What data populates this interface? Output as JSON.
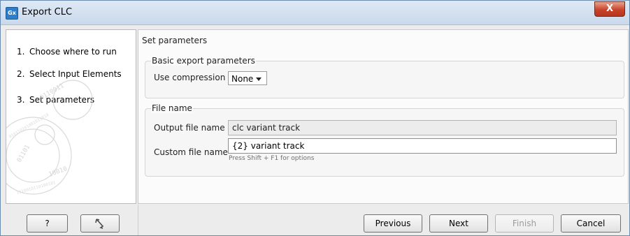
{
  "window": {
    "app_icon": "Gx",
    "title": "Export CLC",
    "close_label": "X"
  },
  "steps": [
    {
      "num": "1.",
      "label": "Choose where to run"
    },
    {
      "num": "2.",
      "label": "Select Input Elements"
    },
    {
      "num": "3.",
      "label": "Set parameters"
    }
  ],
  "content": {
    "section_title": "Set parameters",
    "basic_group": {
      "title": "Basic export parameters",
      "compression_label": "Use compression",
      "compression_value": "None"
    },
    "file_group": {
      "title": "File name",
      "output_label": "Output file name",
      "output_value": "clc variant track",
      "custom_label": "Custom file name",
      "custom_value": "{2} variant track",
      "hint": "Press Shift + F1 for options"
    }
  },
  "buttons": {
    "help": "?",
    "reset_icon": "reset-arrow-icon",
    "previous": "Previous",
    "next": "Next",
    "finish": "Finish",
    "cancel": "Cancel"
  },
  "colors": {
    "close_button": "#c8432b",
    "title_bar": "#dfe9f5",
    "app_icon": "#2f7fc8"
  }
}
